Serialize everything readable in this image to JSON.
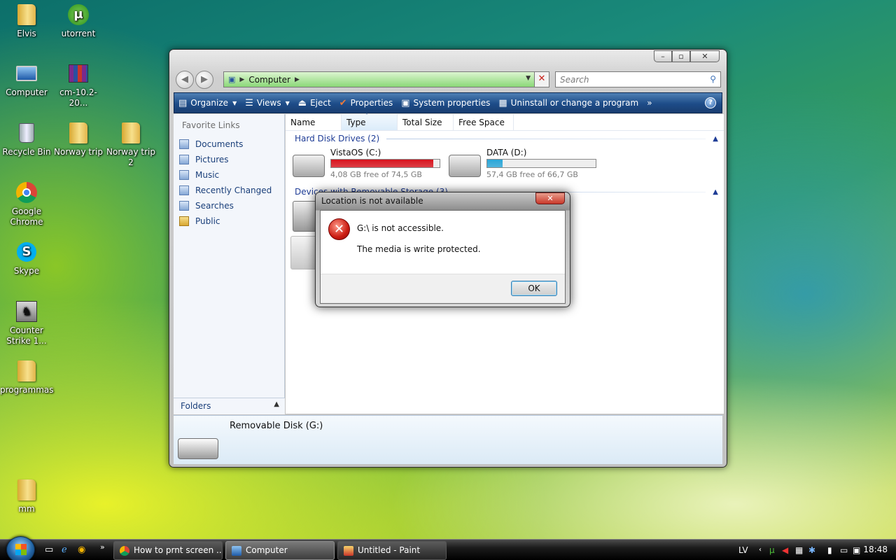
{
  "desktop": {
    "icons": [
      {
        "label": "Elvis",
        "glyph": "folder-icon"
      },
      {
        "label": "utorrent",
        "glyph": "utorrent-icon"
      },
      {
        "label": "Computer",
        "glyph": "computer-icon"
      },
      {
        "label": "cm-10.2-20...",
        "glyph": "winrar-icon"
      },
      {
        "label": "Recycle Bin",
        "glyph": "recycle-bin-icon"
      },
      {
        "label": "Norway trip",
        "glyph": "folder-icon"
      },
      {
        "label": "Norway trip 2",
        "glyph": "folder-icon"
      },
      {
        "label": "Google Chrome",
        "glyph": "chrome-icon"
      },
      {
        "label": "Skype",
        "glyph": "skype-icon"
      },
      {
        "label": "Counter Strike 1...",
        "glyph": "counter-strike-icon"
      },
      {
        "label": "programmas",
        "glyph": "folder-icon"
      },
      {
        "label": "mm",
        "glyph": "folder-icon"
      }
    ]
  },
  "explorer": {
    "address": "Computer",
    "search_placeholder": "Search",
    "toolbar": {
      "organize": "Organize",
      "views": "Views",
      "eject": "Eject",
      "properties": "Properties",
      "system_properties": "System properties",
      "uninstall": "Uninstall or change a program",
      "more": "»",
      "help": "?"
    },
    "favorites": {
      "title": "Favorite Links",
      "items": [
        "Documents",
        "Pictures",
        "Music",
        "Recently Changed",
        "Searches",
        "Public"
      ]
    },
    "folders_label": "Folders",
    "columns": [
      "Name",
      "Type",
      "Total Size",
      "Free Space"
    ],
    "groups": {
      "hdd": "Hard Disk Drives (2)",
      "removable": "Devices with Removable Storage (3)"
    },
    "drives": [
      {
        "name": "VistaOS (C:)",
        "free": "4,08 GB free of 74,5 GB",
        "used_fraction": 0.945,
        "bar_color": "#d8141e"
      },
      {
        "name": "DATA (D:)",
        "free": "57,4 GB free of 66,7 GB",
        "used_fraction": 0.14,
        "bar_color": "#2aa6d8"
      }
    ],
    "details": {
      "name": "Removable Disk (G:)"
    }
  },
  "dialog": {
    "title": "Location is not available",
    "line1": "G:\\ is not accessible.",
    "line2": "The media is write protected.",
    "ok": "OK"
  },
  "taskbar": {
    "tasks": [
      "How to prnt screen ...",
      "Computer",
      "Untitled - Paint"
    ],
    "lang": "LV",
    "time": "18:48"
  }
}
